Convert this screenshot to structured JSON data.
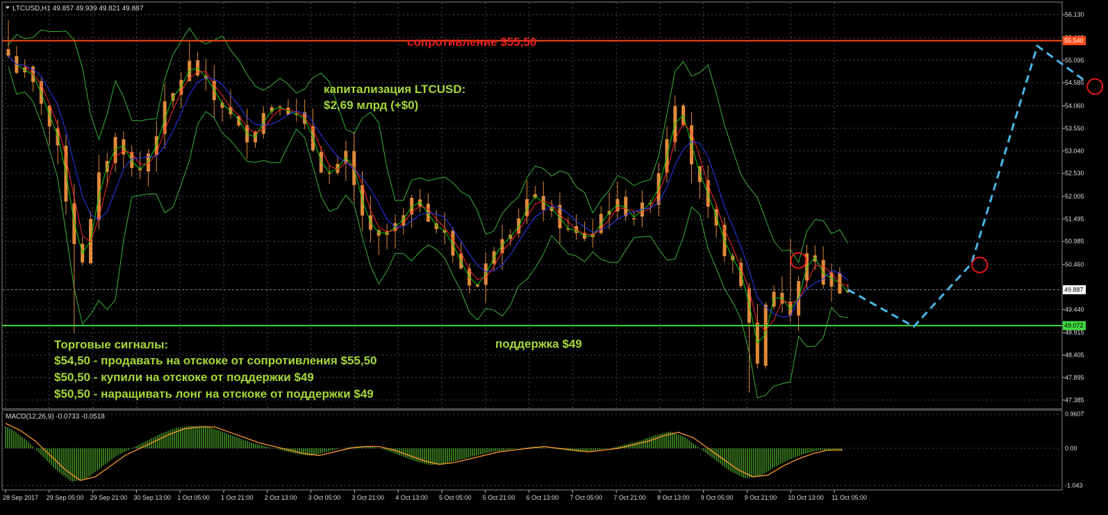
{
  "window": {
    "header": "LTCUSD,H1  49.857 49.939 49.821 49.887",
    "macd_header": "MACD(12,26,9) -0.0733 -0.0518"
  },
  "annotations": {
    "resistance": "сопротивление $55,50",
    "cap_line1": "капитализация LTCUSD:",
    "cap_line2": "$2,69 млрд (+$0)",
    "support": "поддержка $49",
    "signals_title": "Торговые сигналы:",
    "signal1": "$54,50 - продавать на отскоке от сопротивления $55,50",
    "signal2": "$50,50 - купили на отскоке от поддержки $49",
    "signal3": "$50,50 - наращивать лонг на отскоке от поддержки $49"
  },
  "colors": {
    "background": "#000000",
    "grid": "#4a4a66",
    "candle": "#e08a3a",
    "resistance": "#ff4a1a",
    "support": "#3fd83f",
    "bollinger": "#39b539",
    "ma_fast": "#00d000",
    "ma_mid": "#ff2a2a",
    "ma_slow": "#2a3cff",
    "forecast": "#4ab8e8",
    "circle": "#e81a1a",
    "resistance_text": "#e82020",
    "annotation_text": "#a6d83a",
    "macd_hist": "#4fa82a",
    "macd_signal": "#ff9a2a"
  },
  "chart_data": {
    "type": "candlestick",
    "symbol": "LTCUSD",
    "timeframe": "H1",
    "ohlc_last": {
      "open": 49.857,
      "high": 49.939,
      "low": 49.821,
      "close": 49.887
    },
    "y_ticks": [
      "56.130",
      "55.605",
      "55.095",
      "54.585",
      "54.060",
      "53.550",
      "53.040",
      "52.530",
      "52.005",
      "51.495",
      "50.985",
      "50.460",
      "49.440",
      "48.915",
      "48.405",
      "47.895",
      "47.385"
    ],
    "ylim": [
      47.2,
      56.4
    ],
    "price_labels": {
      "resistance": "55.540",
      "current": "49.887",
      "support": "49.072"
    },
    "resistance_level": 55.54,
    "support_level": 49.072,
    "x_labels": [
      "28 Sep 2017",
      "29 Sep 05:00",
      "29 Sep 21:00",
      "30 Sep 13:00",
      "1 Oct 05:00",
      "1 Oct 21:00",
      "2 Oct 13:00",
      "3 Oct 05:00",
      "3 Oct 21:00",
      "4 Oct 13:00",
      "5 Oct 05:00",
      "5 Oct 21:00",
      "6 Oct 13:00",
      "7 Oct 05:00",
      "7 Oct 21:00",
      "8 Oct 13:00",
      "9 Oct 05:00",
      "9 Oct 21:00",
      "10 Oct 13:00",
      "11 Oct 05:00"
    ],
    "close_path": [
      55.2,
      54.9,
      54.8,
      54.5,
      54.2,
      53.6,
      53.0,
      52.0,
      51.0,
      50.6,
      51.4,
      52.4,
      52.9,
      53.3,
      53.1,
      52.6,
      52.6,
      53.0,
      53.5,
      54.0,
      54.3,
      54.7,
      55.0,
      54.8,
      54.5,
      54.2,
      54.1,
      53.8,
      53.5,
      53.4,
      53.6,
      53.9,
      54.1,
      54.2,
      54.0,
      53.8,
      53.5,
      53.1,
      52.7,
      52.5,
      52.6,
      52.9,
      52.2,
      51.6,
      51.1,
      51.0,
      51.2,
      51.3,
      51.5,
      51.8,
      51.9,
      51.6,
      51.3,
      51.1,
      50.7,
      50.4,
      50.1,
      50.0,
      50.4,
      50.9,
      51.2,
      51.3,
      51.6,
      51.9,
      51.9,
      51.8,
      51.6,
      51.4,
      51.2,
      51.1,
      51.1,
      51.2,
      51.6,
      51.8,
      51.8,
      51.7,
      51.6,
      51.7,
      52.0,
      52.6,
      53.4,
      54.2,
      53.8,
      52.8,
      52.2,
      51.6,
      51.2,
      50.8,
      50.4,
      49.9,
      49.2,
      48.2,
      49.6,
      49.9,
      49.6,
      49.3,
      50.0,
      50.8,
      50.4,
      50.1,
      50.2,
      49.95,
      49.887
    ],
    "forecast_path": [
      {
        "bar": 102,
        "price": 49.887
      },
      {
        "bar": 110,
        "price": 49.05
      },
      {
        "bar": 117,
        "price": 50.48
      },
      {
        "bar": 125,
        "price": 55.42
      },
      {
        "bar": 131,
        "price": 54.6
      }
    ],
    "circles": [
      {
        "bar": 96,
        "price": 50.55
      },
      {
        "bar": 118,
        "price": 50.45
      },
      {
        "bar": 132,
        "price": 54.5
      }
    ],
    "macd": {
      "y_ticks": [
        "0.9607",
        "0.00",
        "-1.043"
      ],
      "ylim": [
        -1.15,
        1.05
      ],
      "signal_path": [
        0.7,
        0.5,
        0.2,
        -0.2,
        -0.6,
        -0.9,
        -0.8,
        -0.5,
        -0.2,
        0.0,
        0.2,
        0.4,
        0.55,
        0.6,
        0.6,
        0.45,
        0.3,
        0.15,
        0.05,
        -0.05,
        -0.15,
        -0.2,
        -0.1,
        0.0,
        0.05,
        0.05,
        -0.05,
        -0.2,
        -0.35,
        -0.45,
        -0.4,
        -0.3,
        -0.2,
        -0.1,
        -0.05,
        0.0,
        0.05,
        0.0,
        -0.05,
        -0.1,
        -0.05,
        0.0,
        0.1,
        0.2,
        0.35,
        0.45,
        0.3,
        0.0,
        -0.3,
        -0.6,
        -0.8,
        -0.75,
        -0.5,
        -0.3,
        -0.15,
        -0.05,
        -0.05
      ]
    }
  }
}
